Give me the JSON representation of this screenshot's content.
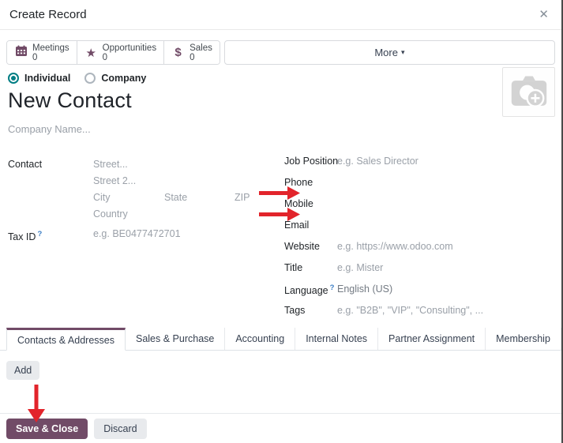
{
  "modal": {
    "title": "Create Record",
    "close_icon": "✕"
  },
  "stat_buttons": [
    {
      "icon": "calendar-icon",
      "label": "Meetings",
      "count": "0"
    },
    {
      "icon": "star-icon",
      "glyph": "★",
      "label": "Opportunities",
      "count": "0"
    },
    {
      "icon": "dollar-icon",
      "glyph": "$",
      "label": "Sales",
      "count": "0"
    }
  ],
  "more_button": {
    "label": "More",
    "caret": "▾"
  },
  "type_selector": {
    "individual": {
      "label": "Individual",
      "selected": true
    },
    "company": {
      "label": "Company",
      "selected": false
    }
  },
  "name_field": {
    "value": "New Contact"
  },
  "company_field": {
    "placeholder": "Company Name..."
  },
  "address": {
    "label": "Contact",
    "street_placeholder": "Street...",
    "street2_placeholder": "Street 2...",
    "city_placeholder": "City",
    "state_placeholder": "State",
    "zip_placeholder": "ZIP",
    "country_placeholder": "Country"
  },
  "tax_id": {
    "label": "Tax ID",
    "help_marker": "?",
    "placeholder": "e.g. BE0477472701"
  },
  "right_fields": [
    {
      "label": "Job Position",
      "value": "e.g. Sales Director"
    },
    {
      "label": "Phone",
      "value": ""
    },
    {
      "label": "Mobile",
      "value": ""
    },
    {
      "label": "Email",
      "value": ""
    },
    {
      "label": "Website",
      "value": "e.g. https://www.odoo.com"
    },
    {
      "label": "Title",
      "value": "e.g. Mister"
    },
    {
      "label": "Language",
      "help_marker": "?",
      "value": "English (US)"
    },
    {
      "label": "Tags",
      "value": "e.g. \"B2B\", \"VIP\", \"Consulting\", ..."
    }
  ],
  "avatar": {
    "icon": "camera-plus-icon"
  },
  "tabs": {
    "active_index": 0,
    "items": [
      {
        "label": "Contacts & Addresses"
      },
      {
        "label": "Sales & Purchase"
      },
      {
        "label": "Accounting"
      },
      {
        "label": "Internal Notes"
      },
      {
        "label": "Partner Assignment"
      },
      {
        "label": "Membership"
      }
    ]
  },
  "tab_content": {
    "add_label": "Add"
  },
  "footer": {
    "save_label": "Save & Close",
    "discard_label": "Discard"
  },
  "annotations": {
    "color": "#e2242b",
    "arrows": [
      {
        "target": "mobile-field",
        "direction": "right"
      },
      {
        "target": "email-field",
        "direction": "right"
      },
      {
        "target": "save-close-button",
        "direction": "down"
      }
    ]
  },
  "colors": {
    "primary": "#714B67",
    "radio_accent": "#017E84",
    "annotation_red": "#e2242b",
    "placeholder_gray": "#9aa0a8",
    "help_blue": "#3b7dc4"
  }
}
